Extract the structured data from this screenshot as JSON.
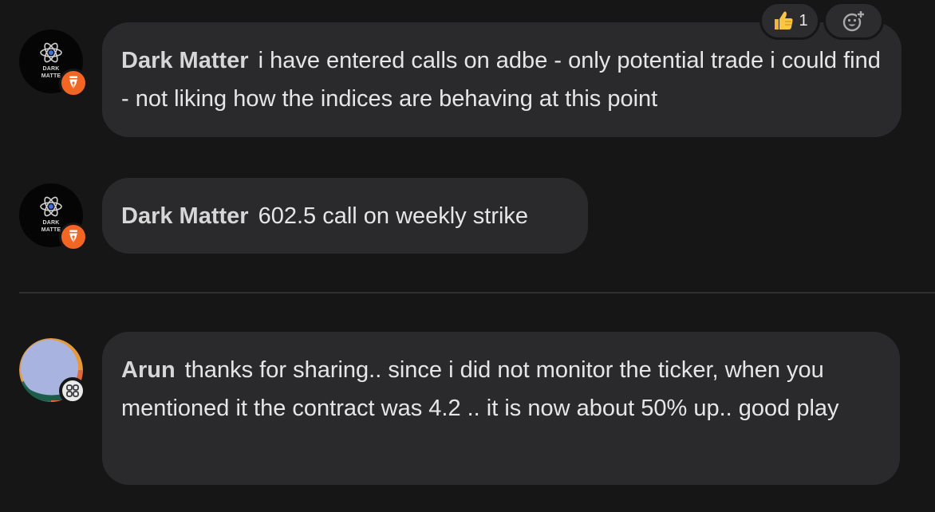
{
  "messages": [
    {
      "author": "Dark Matter",
      "text": "i have entered calls on adbe - only potential trade i could find - not liking how the indices are behaving at this point",
      "avatar_logo_text": [
        "DARK",
        "MATTE"
      ],
      "reactions": {
        "thumbs_up_icon": "thumbs-up-icon",
        "thumbs_up_count": "1",
        "add_reaction_icon": "add-reaction-icon"
      }
    },
    {
      "author": "Dark Matter",
      "text": "602.5 call on weekly strike",
      "avatar_logo_text": [
        "DARK",
        "MATTE"
      ]
    },
    {
      "author": "Arun",
      "text": "thanks for sharing.. since i did not monitor the ticker, when you mentioned it the contract was 4.2 .. it is now about 50% up.. good play"
    }
  ],
  "colors": {
    "background": "#161617",
    "bubble": "#2a2a2c",
    "creator_badge": "#f26522",
    "text": "#e6e6e7"
  }
}
